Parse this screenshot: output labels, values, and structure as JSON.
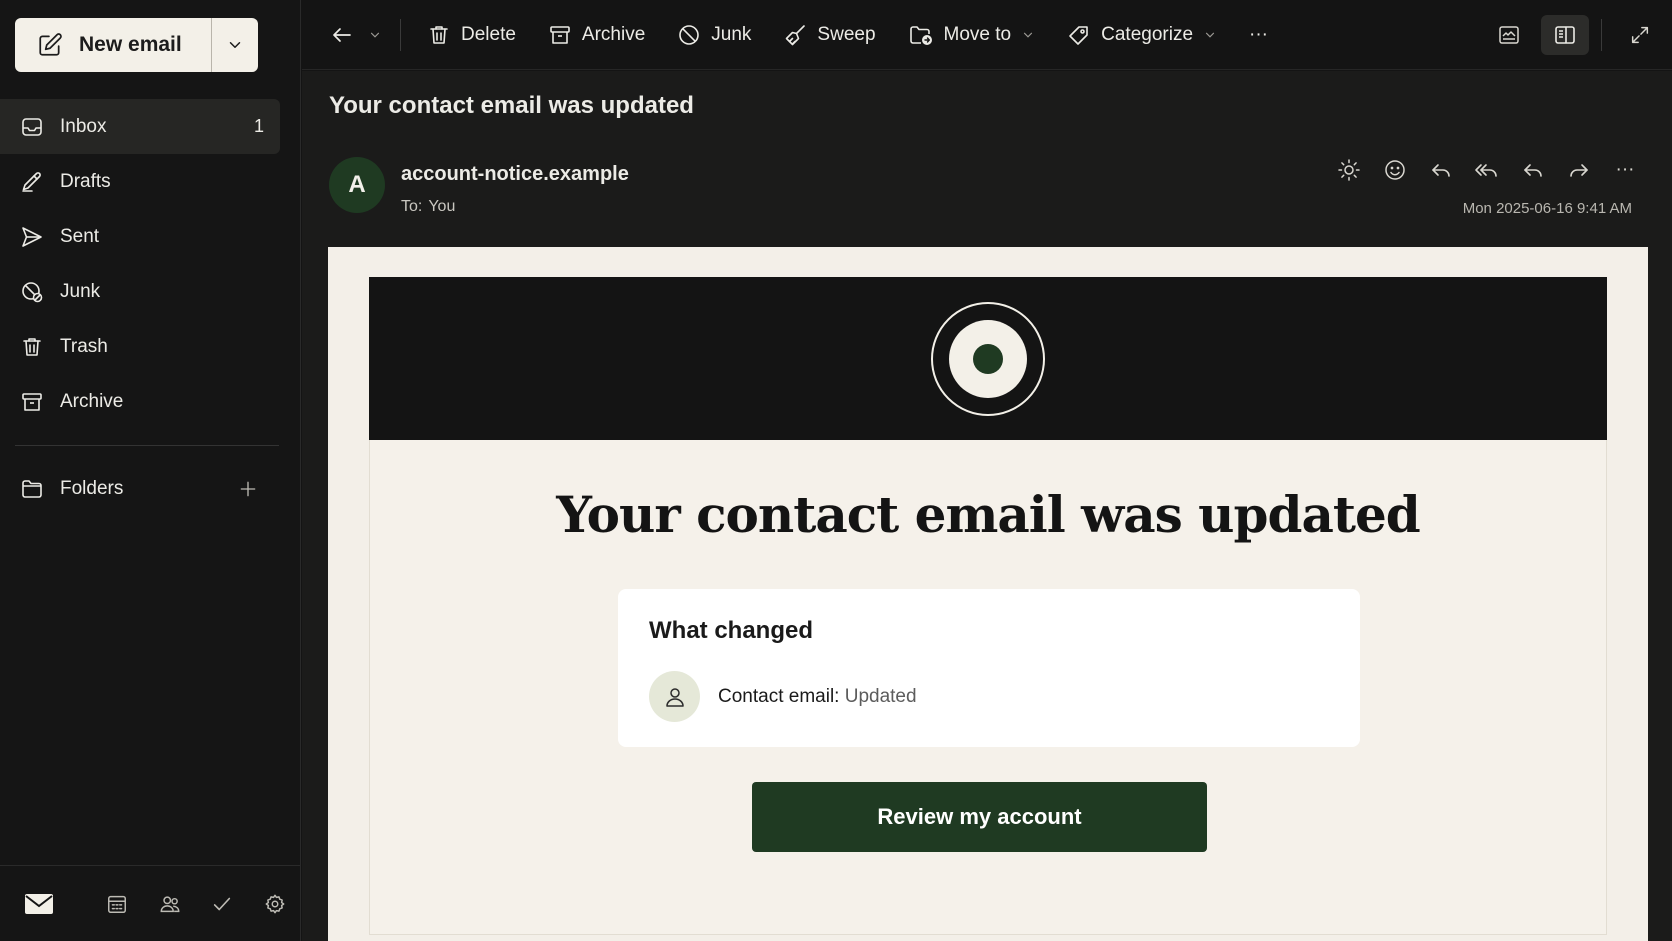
{
  "sidebar": {
    "new_email_label": "New email",
    "items": [
      {
        "label": "Inbox",
        "count": "1"
      },
      {
        "label": "Drafts"
      },
      {
        "label": "Sent"
      },
      {
        "label": "Junk"
      },
      {
        "label": "Trash"
      },
      {
        "label": "Archive"
      }
    ],
    "folders_label": "Folders"
  },
  "toolbar": {
    "delete_label": "Delete",
    "archive_label": "Archive",
    "junk_label": "Junk",
    "sweep_label": "Sweep",
    "move_to_label": "Move to",
    "categorize_label": "Categorize",
    "more_label": "···"
  },
  "message": {
    "subject": "Your contact email was updated",
    "avatar_initial": "A",
    "sender": "account-notice.example",
    "to_prefix": "To:",
    "to_value": "You",
    "date": "Mon 2025-06-16 9:41 AM",
    "more_label": "···"
  },
  "email": {
    "heading": "Your contact email was updated",
    "card_title": "What changed",
    "change_label": "Contact email:",
    "change_value": "Updated",
    "cta_label": "Review my account"
  },
  "colors": {
    "accent": "#1f3a22",
    "background": "#141414",
    "email_bg": "#f3efe8"
  }
}
